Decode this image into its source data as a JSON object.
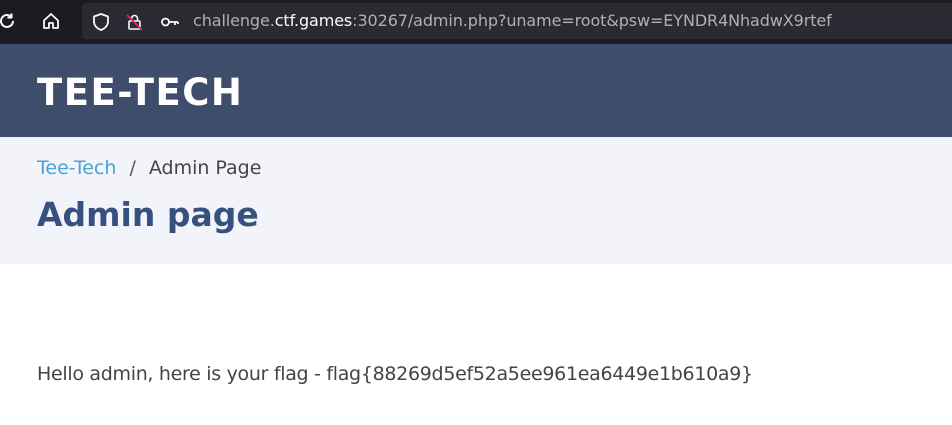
{
  "browser": {
    "url_host_prefix": "challenge.",
    "url_host": "ctf.games",
    "url_rest": ":30267/admin.php?uname=root&psw=EYNDR4NhadwX9rtef",
    "icons": [
      "reload-icon",
      "home-icon",
      "shield-icon",
      "permissions-icon",
      "key-icon"
    ]
  },
  "header": {
    "logo": "TEE-TECH"
  },
  "breadcrumb": {
    "home_label": "Tee-Tech",
    "separator": "/",
    "current_label": "Admin Page"
  },
  "page": {
    "title": "Admin page",
    "message": "Hello admin, here is your flag - flag{88269d5ef52a5ee961ea6449e1b610a9}"
  },
  "colors": {
    "header_bg": "#3d4d6b",
    "breadcrumb_bg": "#f3f4f9",
    "title": "#37517e",
    "link": "#4ba3d6",
    "browser_bg": "#1c1b22"
  }
}
